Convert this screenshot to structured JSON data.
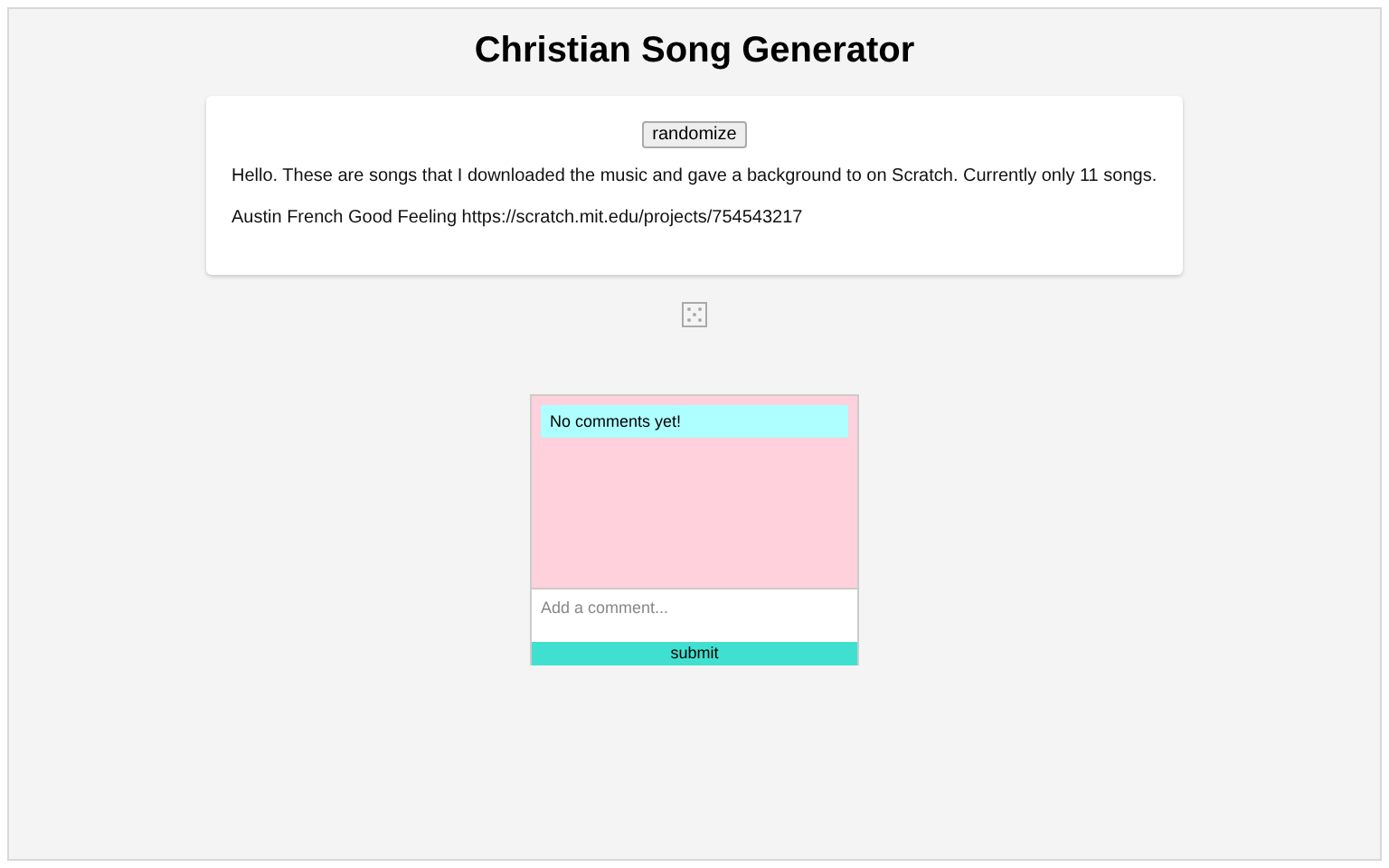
{
  "title": "Christian Song Generator",
  "card": {
    "button": "randomize",
    "intro": "Hello. These are songs that I downloaded the music and gave a background to on Scratch. Currently only 11 songs.",
    "song": "Austin French Good Feeling https://scratch.mit.edu/projects/754543217"
  },
  "comments": {
    "empty_message": "No comments yet!",
    "placeholder": "Add a comment...",
    "submit": "submit"
  }
}
